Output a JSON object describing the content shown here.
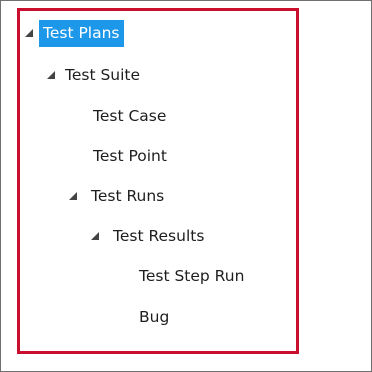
{
  "tree": {
    "items": [
      {
        "label": "Test Plans",
        "expanded": true,
        "selected": true
      },
      {
        "label": "Test Suite",
        "expanded": true
      },
      {
        "label": "Test Case"
      },
      {
        "label": "Test Point"
      },
      {
        "label": "Test Runs",
        "expanded": true
      },
      {
        "label": "Test Results",
        "expanded": true
      },
      {
        "label": "Test Step Run"
      },
      {
        "label": "Bug"
      }
    ]
  },
  "colors": {
    "selection": "#1c97ea",
    "highlight_border": "#c8102e"
  },
  "icons": {
    "expander": "triangle-expanded-icon"
  }
}
